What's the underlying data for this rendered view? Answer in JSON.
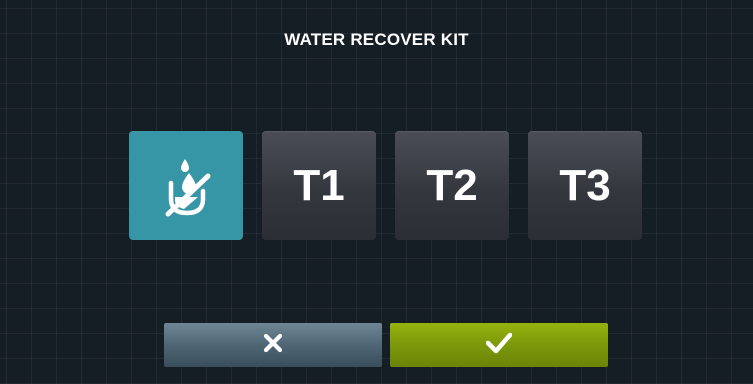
{
  "screen": {
    "title": "WATER RECOVER KIT"
  },
  "options": [
    {
      "label": "",
      "icon": "water-recovery-disabled-icon",
      "selected": true
    },
    {
      "label": "T1",
      "selected": false
    },
    {
      "label": "T2",
      "selected": false
    },
    {
      "label": "T3",
      "selected": false
    }
  ],
  "actions": {
    "cancel_icon": "close-icon",
    "confirm_icon": "check-icon"
  },
  "colors": {
    "background": "#151d25",
    "selected": "#3796a5",
    "button_dark": "#34373e",
    "cancel": "#4f6674",
    "confirm": "#7a960a"
  }
}
